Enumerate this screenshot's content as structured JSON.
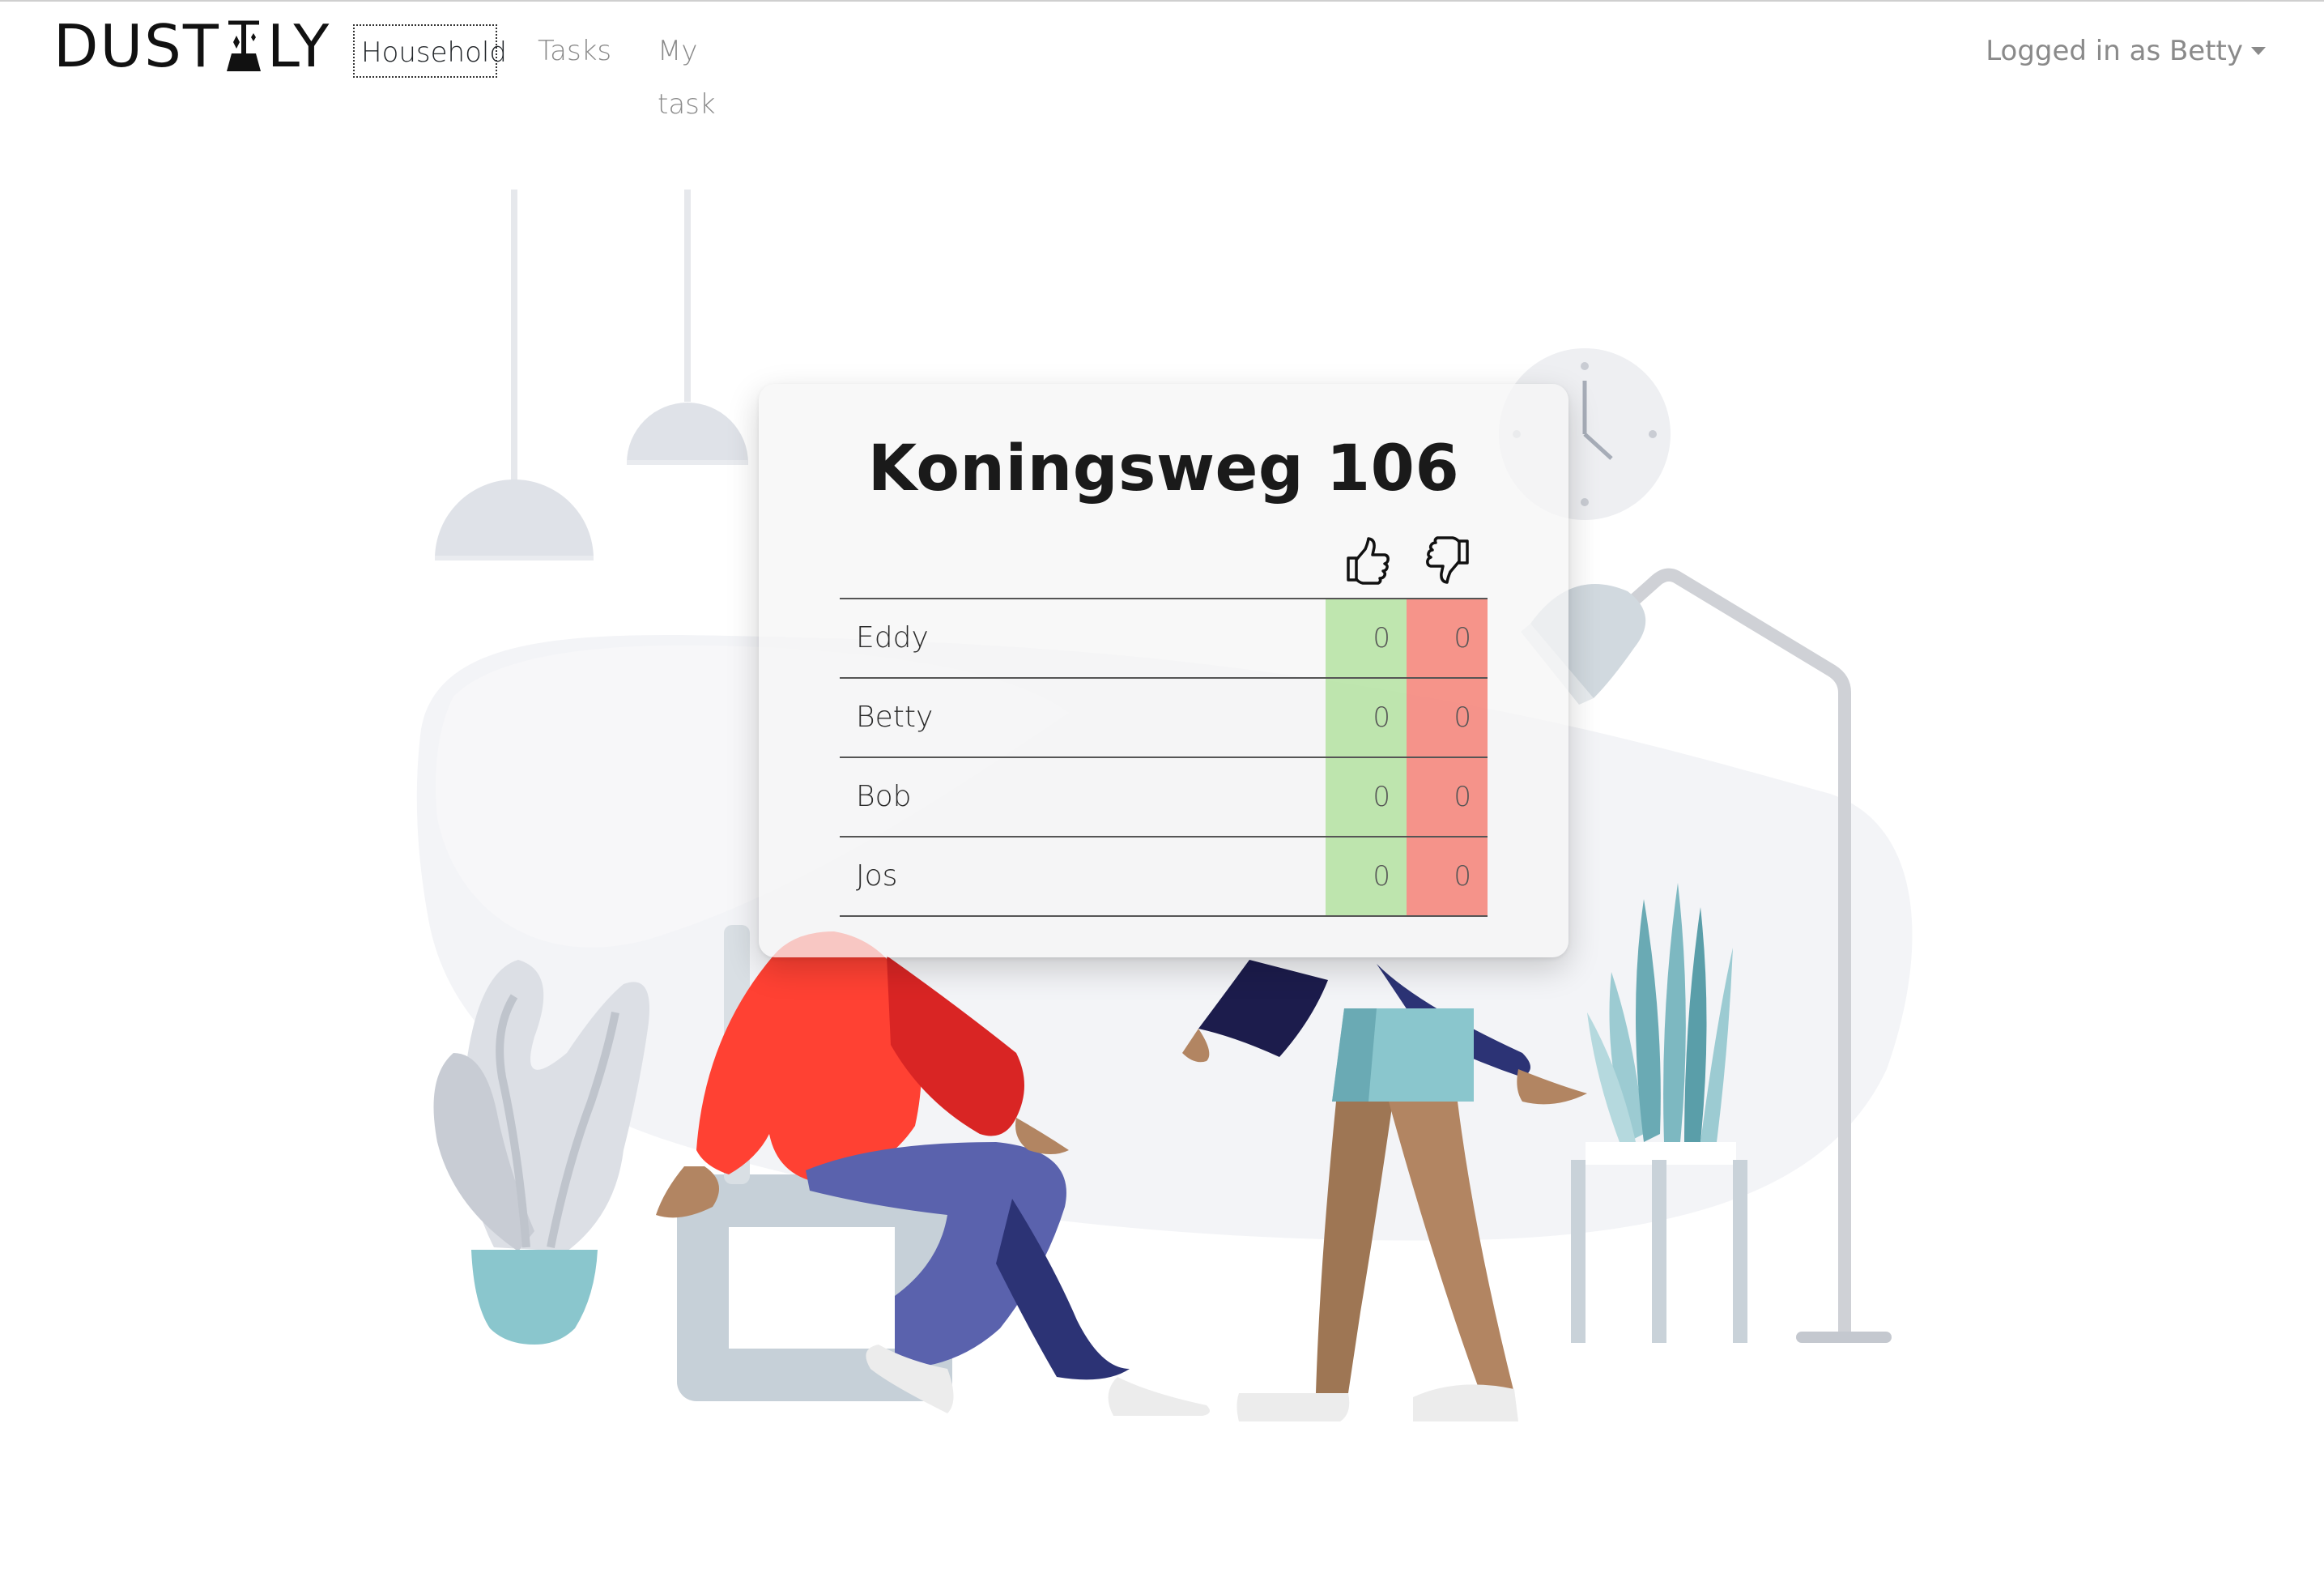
{
  "app": {
    "brand": "DUSTLY",
    "brand_before_icon": "DUST",
    "brand_after_icon": "LY",
    "brand_icon": "broom-icon"
  },
  "nav": {
    "items": [
      {
        "label": "Household",
        "active": true
      },
      {
        "label": "Tasks",
        "active": false
      },
      {
        "label": "My task",
        "active": false
      }
    ],
    "user_menu_label": "Logged in as Betty",
    "user_menu_icon": "caret-down-icon"
  },
  "household": {
    "title": "Koningsweg 106",
    "vote_icons": {
      "up": "thumbs-up-icon",
      "down": "thumbs-down-icon"
    },
    "members": [
      {
        "name": "Eddy",
        "up": "0",
        "down": "0"
      },
      {
        "name": "Betty",
        "up": "0",
        "down": "0"
      },
      {
        "name": "Bob",
        "up": "0",
        "down": "0"
      },
      {
        "name": "Jos",
        "up": "0",
        "down": "0"
      }
    ]
  },
  "colors": {
    "up_cell": "#a0dc87",
    "down_cell": "#f56e5f",
    "active_nav_text": "#212529",
    "inactive_nav_text": "#8a8a8a"
  }
}
